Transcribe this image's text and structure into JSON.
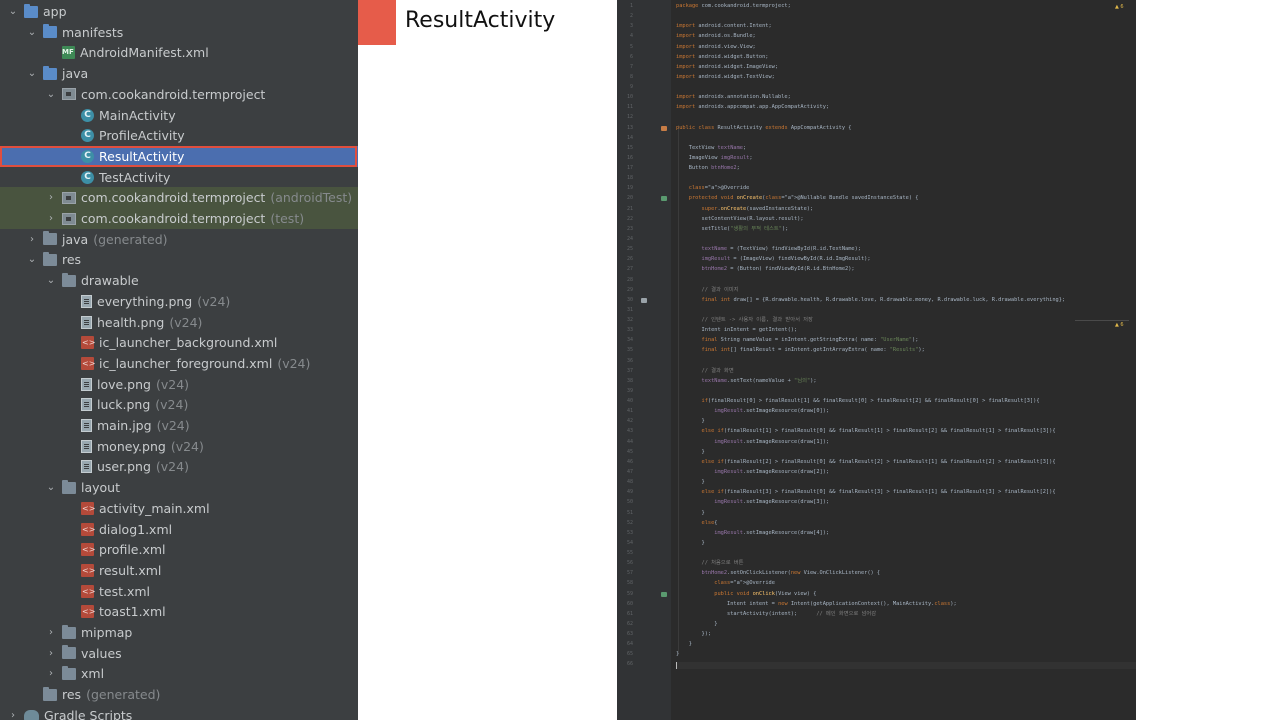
{
  "tree": {
    "items": [
      {
        "label": "app",
        "suffix": "",
        "icon": "folder-blue-icon",
        "level": 0,
        "arrow": "open"
      },
      {
        "label": "manifests",
        "suffix": "",
        "icon": "folder-blue-icon",
        "level": 1,
        "arrow": "open"
      },
      {
        "label": "AndroidManifest.xml",
        "suffix": "",
        "icon": "manifest-icon",
        "level": 2,
        "arrow": ""
      },
      {
        "label": "java",
        "suffix": "",
        "icon": "folder-blue-icon",
        "level": 1,
        "arrow": "open"
      },
      {
        "label": "com.cookandroid.termproject",
        "suffix": "",
        "icon": "package-icon",
        "level": 2,
        "arrow": "open"
      },
      {
        "label": "MainActivity",
        "suffix": "",
        "icon": "class-icon",
        "level": 3,
        "arrow": ""
      },
      {
        "label": "ProfileActivity",
        "suffix": "",
        "icon": "class-icon",
        "level": 3,
        "arrow": ""
      },
      {
        "label": "ResultActivity",
        "suffix": "",
        "icon": "class-icon",
        "level": 3,
        "arrow": "",
        "selected": true
      },
      {
        "label": "TestActivity",
        "suffix": "",
        "icon": "class-icon",
        "level": 3,
        "arrow": ""
      },
      {
        "label": "com.cookandroid.termproject",
        "suffix": "(androidTest)",
        "icon": "package-icon",
        "level": 2,
        "arrow": "closed",
        "test": true
      },
      {
        "label": "com.cookandroid.termproject",
        "suffix": "(test)",
        "icon": "package-icon",
        "level": 2,
        "arrow": "closed",
        "test": true
      },
      {
        "label": "java",
        "suffix": "(generated)",
        "icon": "folder-icon",
        "level": 1,
        "arrow": "closed"
      },
      {
        "label": "res",
        "suffix": "",
        "icon": "folder-icon",
        "level": 1,
        "arrow": "open"
      },
      {
        "label": "drawable",
        "suffix": "",
        "icon": "folder-icon",
        "level": 2,
        "arrow": "open"
      },
      {
        "label": "everything.png",
        "suffix": "(v24)",
        "icon": "image-file-icon",
        "level": 3,
        "arrow": ""
      },
      {
        "label": "health.png",
        "suffix": "(v24)",
        "icon": "image-file-icon",
        "level": 3,
        "arrow": ""
      },
      {
        "label": "ic_launcher_background.xml",
        "suffix": "",
        "icon": "xml-file-icon",
        "level": 3,
        "arrow": ""
      },
      {
        "label": "ic_launcher_foreground.xml",
        "suffix": "(v24)",
        "icon": "xml-file-icon",
        "level": 3,
        "arrow": ""
      },
      {
        "label": "love.png",
        "suffix": "(v24)",
        "icon": "image-file-icon",
        "level": 3,
        "arrow": ""
      },
      {
        "label": "luck.png",
        "suffix": "(v24)",
        "icon": "image-file-icon",
        "level": 3,
        "arrow": ""
      },
      {
        "label": "main.jpg",
        "suffix": "(v24)",
        "icon": "image-file-icon",
        "level": 3,
        "arrow": ""
      },
      {
        "label": "money.png",
        "suffix": "(v24)",
        "icon": "image-file-icon",
        "level": 3,
        "arrow": ""
      },
      {
        "label": "user.png",
        "suffix": "(v24)",
        "icon": "image-file-icon",
        "level": 3,
        "arrow": ""
      },
      {
        "label": "layout",
        "suffix": "",
        "icon": "folder-icon",
        "level": 2,
        "arrow": "open"
      },
      {
        "label": "activity_main.xml",
        "suffix": "",
        "icon": "xml-file-icon",
        "level": 3,
        "arrow": ""
      },
      {
        "label": "dialog1.xml",
        "suffix": "",
        "icon": "xml-file-icon",
        "level": 3,
        "arrow": ""
      },
      {
        "label": "profile.xml",
        "suffix": "",
        "icon": "xml-file-icon",
        "level": 3,
        "arrow": ""
      },
      {
        "label": "result.xml",
        "suffix": "",
        "icon": "xml-file-icon",
        "level": 3,
        "arrow": ""
      },
      {
        "label": "test.xml",
        "suffix": "",
        "icon": "xml-file-icon",
        "level": 3,
        "arrow": ""
      },
      {
        "label": "toast1.xml",
        "suffix": "",
        "icon": "xml-file-icon",
        "level": 3,
        "arrow": ""
      },
      {
        "label": "mipmap",
        "suffix": "",
        "icon": "folder-icon",
        "level": 2,
        "arrow": "closed"
      },
      {
        "label": "values",
        "suffix": "",
        "icon": "folder-icon",
        "level": 2,
        "arrow": "closed"
      },
      {
        "label": "xml",
        "suffix": "",
        "icon": "folder-icon",
        "level": 2,
        "arrow": "closed"
      },
      {
        "label": "res",
        "suffix": "(generated)",
        "icon": "folder-icon",
        "level": 1,
        "arrow": ""
      },
      {
        "label": "Gradle Scripts",
        "suffix": "",
        "icon": "gradle-icon",
        "level": 0,
        "arrow": "closed"
      }
    ]
  },
  "header": {
    "title": "ResultActivity"
  },
  "colors": {
    "label_bar": "#e65c4a",
    "selection_outline": "#e04e3e",
    "tree_bg": "#3c3f41",
    "editor_bg": "#2b2b2b"
  },
  "editor": {
    "warning_badge": "▲ 6",
    "lines": [
      "package com.cookandroid.termproject;",
      "",
      "import android.content.Intent;",
      "import android.os.Bundle;",
      "import android.view.View;",
      "import android.widget.Button;",
      "import android.widget.ImageView;",
      "import android.widget.TextView;",
      "",
      "import androidx.annotation.Nullable;",
      "import androidx.appcompat.app.AppCompatActivity;",
      "",
      "public class ResultActivity extends AppCompatActivity {",
      "",
      "    TextView textName;",
      "    ImageView imgResult;",
      "    Button btnHome2;",
      "",
      "    @Override",
      "    protected void onCreate(@Nullable Bundle savedInstanceState) {",
      "        super.onCreate(savedInstanceState);",
      "        setContentView(R.layout.result);",
      "        setTitle(\"생활의 부적 테스트\");",
      "",
      "        textName = (TextView) findViewById(R.id.TextName);",
      "        imgResult = (ImageView) findViewById(R.id.ImgResult);",
      "        btnHome2 = (Button) findViewById(R.id.BtnHome2);",
      "",
      "        // 결과 이미지",
      "        final int draw[] = {R.drawable.health, R.drawable.love, R.drawable.money, R.drawable.luck, R.drawable.everything};",
      "",
      "        // 인텐트 -> 사용자 이름, 결과 받아서 저장",
      "        Intent inIntent = getIntent();",
      "        final String nameValue = inIntent.getStringExtra( name: \"UserName\");",
      "        final int[] finalResult = inIntent.getIntArrayExtra( name: \"Results\");",
      "",
      "        // 결과 화면",
      "        textName.setText(nameValue + \"님의\");",
      "",
      "        if(finalResult[0] > finalResult[1] && finalResult[0] > finalResult[2] && finalResult[0] > finalResult[3]){",
      "            imgResult.setImageResource(draw[0]);",
      "        }",
      "        else if(finalResult[1] > finalResult[0] && finalResult[1] > finalResult[2] && finalResult[1] > finalResult[3]){",
      "            imgResult.setImageResource(draw[1]);",
      "        }",
      "        else if(finalResult[2] > finalResult[0] && finalResult[2] > finalResult[1] && finalResult[2] > finalResult[3]){",
      "            imgResult.setImageResource(draw[2]);",
      "        }",
      "        else if(finalResult[3] > finalResult[0] && finalResult[3] > finalResult[1] && finalResult[3] > finalResult[2]){",
      "            imgResult.setImageResource(draw[3]);",
      "        }",
      "        else{",
      "            imgResult.setImageResource(draw[4]);",
      "        }",
      "",
      "        // 처음으로 버튼",
      "        btnHome2.setOnClickListener(new View.OnClickListener() {",
      "            @Override",
      "            public void onClick(View view) {",
      "                Intent intent = new Intent(getApplicationContext(), MainActivity.class);",
      "                startActivity(intent);      // 메인 화면으로 넘어감",
      "            }",
      "        });",
      "    }",
      "}",
      ""
    ]
  }
}
